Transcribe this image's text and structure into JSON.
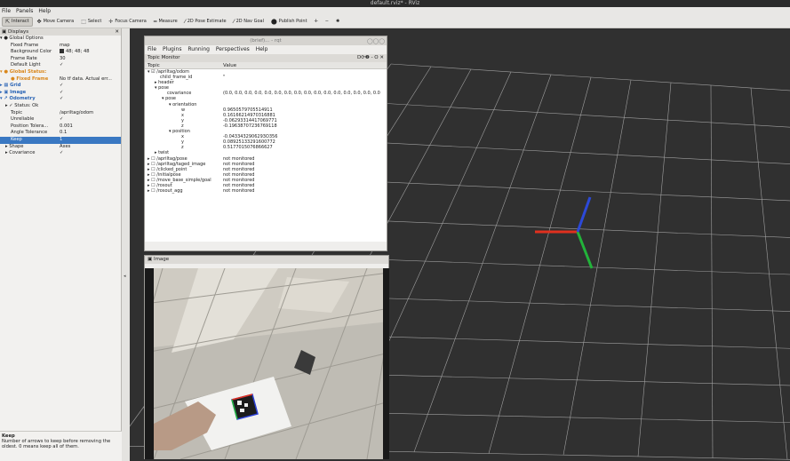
{
  "window": {
    "title": "default.rviz* - RViz"
  },
  "menubar": [
    {
      "label": "File"
    },
    {
      "label": "Panels"
    },
    {
      "label": "Help"
    }
  ],
  "toolbar": {
    "tools": [
      {
        "label": "Interact",
        "icon": "interact-icon",
        "glyph": "⇱",
        "active": true
      },
      {
        "label": "Move Camera",
        "icon": "move-camera-icon",
        "glyph": "✥",
        "active": false
      },
      {
        "label": "Select",
        "icon": "select-icon",
        "glyph": "⬚",
        "active": false
      },
      {
        "label": "Focus Camera",
        "icon": "focus-camera-icon",
        "glyph": "✛",
        "active": false
      },
      {
        "label": "Measure",
        "icon": "measure-icon",
        "glyph": "═",
        "active": false
      },
      {
        "label": "2D Pose Estimate",
        "icon": "pose-estimate-icon",
        "glyph": "⁄",
        "active": false
      },
      {
        "label": "2D Nav Goal",
        "icon": "nav-goal-icon",
        "glyph": "⁄",
        "active": false
      },
      {
        "label": "Publish Point",
        "icon": "publish-point-icon",
        "glyph": "⬤",
        "active": false
      }
    ],
    "extra": [
      {
        "icon": "add-tool-icon",
        "glyph": "✛"
      },
      {
        "icon": "remove-tool-icon",
        "glyph": "−"
      },
      {
        "icon": "tool-settings-icon",
        "glyph": "✺"
      }
    ]
  },
  "displays": {
    "header": "Displays",
    "rows": [
      {
        "k": "▾ ● Global Options",
        "v": "",
        "cls": "",
        "indent": 0
      },
      {
        "k": "Fixed Frame",
        "v": "map",
        "cls": "",
        "indent": 12
      },
      {
        "k": "Background Color",
        "v": "48; 48; 48",
        "cls": "",
        "indent": 12,
        "swatch": true
      },
      {
        "k": "Frame Rate",
        "v": "30",
        "cls": "",
        "indent": 12
      },
      {
        "k": "Default Light",
        "v": "✓",
        "cls": "",
        "indent": 12
      },
      {
        "k": "▾ ● Global Status:",
        "v": "",
        "cls": "orange",
        "indent": 0
      },
      {
        "k": "● Fixed Frame",
        "v": "No tf data.  Actual err...",
        "cls": "orange",
        "indent": 12
      },
      {
        "k": "▸ ▦ Grid",
        "v": "✓",
        "cls": "blue",
        "indent": 0
      },
      {
        "k": "▸ ▣ Image",
        "v": "✓",
        "cls": "blue",
        "indent": 0
      },
      {
        "k": "▾ ↗ Odometry",
        "v": "✓",
        "cls": "blue",
        "indent": 0
      },
      {
        "k": "▸ ✓ Status: Ok",
        "v": "",
        "cls": "",
        "indent": 6
      },
      {
        "k": "Topic",
        "v": "/apriltag/odom",
        "cls": "",
        "indent": 12
      },
      {
        "k": "Unreliable",
        "v": "✓",
        "cls": "",
        "indent": 12
      },
      {
        "k": "Position Tolera...",
        "v": "0.001",
        "cls": "",
        "indent": 12
      },
      {
        "k": "Angle Tolerance",
        "v": "0.1",
        "cls": "",
        "indent": 12
      },
      {
        "k": "Keep",
        "v": "1",
        "cls": "sel",
        "indent": 12
      },
      {
        "k": "▸ Shape",
        "v": "Axes",
        "cls": "",
        "indent": 6
      },
      {
        "k": "▸ Covariance",
        "v": "✓",
        "cls": "",
        "indent": 6
      }
    ]
  },
  "help": {
    "title": "Keep",
    "text": "Number of arrows to keep before removing the oldest. 0 means keep all of them."
  },
  "rqt": {
    "title": "(brief)... - rqt",
    "menu": [
      "File",
      "Plugins",
      "Running",
      "Perspectives",
      "Help"
    ],
    "plugin_title": "Topic Monitor",
    "plugin_buttons": "D⟳❷ - O ✕",
    "col_topic": "Topic",
    "col_value": "Value",
    "rows": [
      {
        "k": "▾ ☑ /apriltag/odom",
        "v": "",
        "indent": 3
      },
      {
        "k": "child_frame_id",
        "v": "\"",
        "indent": 17
      },
      {
        "k": "▸ header",
        "v": "",
        "indent": 11
      },
      {
        "k": "▾ pose",
        "v": "",
        "indent": 11
      },
      {
        "k": "covariance",
        "v": "(0.0, 0.0, 0.0, 0.0, 0.0, 0.0, 0.0, 0.0, 0.0, 0.0, 0.0, 0.0, 0.0, 0.0, 0.0, 0.0",
        "indent": 25
      },
      {
        "k": "▾ pose",
        "v": "",
        "indent": 19
      },
      {
        "k": "▾ orientation",
        "v": "",
        "indent": 27
      },
      {
        "k": "w",
        "v": "0.9650579705514911",
        "indent": 41
      },
      {
        "k": "x",
        "v": "0.16166214970316881",
        "indent": 41
      },
      {
        "k": "y",
        "v": "-0.06293314417069771",
        "indent": 41
      },
      {
        "k": "z",
        "v": "-0.19638707236769118",
        "indent": 41
      },
      {
        "k": "▾ position",
        "v": "",
        "indent": 27
      },
      {
        "k": "x",
        "v": "-0.0433432906293O356",
        "indent": 41
      },
      {
        "k": "y",
        "v": "0.08925133291600772",
        "indent": 41
      },
      {
        "k": "z",
        "v": "0.5177015076866627",
        "indent": 41
      },
      {
        "k": "▸ twist",
        "v": "",
        "indent": 11
      },
      {
        "k": "▸ ☐ /apriltag/pose",
        "v": "not monitored",
        "indent": 3
      },
      {
        "k": "▸ ☐ /apriltag/taged_image",
        "v": "not monitored",
        "indent": 3
      },
      {
        "k": "▸ ☐ /clicked_point",
        "v": "not monitored",
        "indent": 3
      },
      {
        "k": "▸ ☐ /initialpose",
        "v": "not monitored",
        "indent": 3
      },
      {
        "k": "▸ ☐ /move_base_simple/goal",
        "v": "not monitored",
        "indent": 3
      },
      {
        "k": "▸ ☐ /rosout",
        "v": "not monitored",
        "indent": 3
      },
      {
        "k": "▸ ☐ /rosout_agg",
        "v": "not monitored",
        "indent": 3
      }
    ]
  },
  "image_panel": {
    "title": "Image"
  },
  "colors": {
    "background": "#303030",
    "grid": "#a0a0a0",
    "axis_x": "#e0301e",
    "axis_y": "#22b33a",
    "axis_z": "#2c49d8",
    "selection": "#3a78c2"
  }
}
